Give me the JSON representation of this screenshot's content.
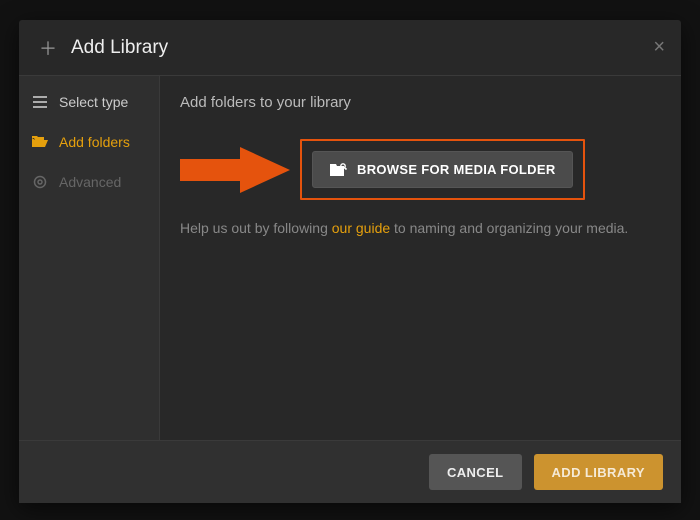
{
  "modal": {
    "title": "Add Library",
    "close_glyph": "×",
    "plus_glyph": "＋"
  },
  "sidebar": {
    "items": [
      {
        "label": "Select type",
        "state": "normal"
      },
      {
        "label": "Add folders",
        "state": "active"
      },
      {
        "label": "Advanced",
        "state": "disabled"
      }
    ]
  },
  "content": {
    "heading": "Add folders to your library",
    "browse_label": "BROWSE FOR MEDIA FOLDER",
    "help_pre": "Help us out by following ",
    "help_link": "our guide",
    "help_post": " to naming and organizing your media."
  },
  "footer": {
    "cancel": "CANCEL",
    "primary": "ADD LIBRARY"
  },
  "colors": {
    "accent": "#e5a00d",
    "highlight_border": "#e5530d"
  }
}
